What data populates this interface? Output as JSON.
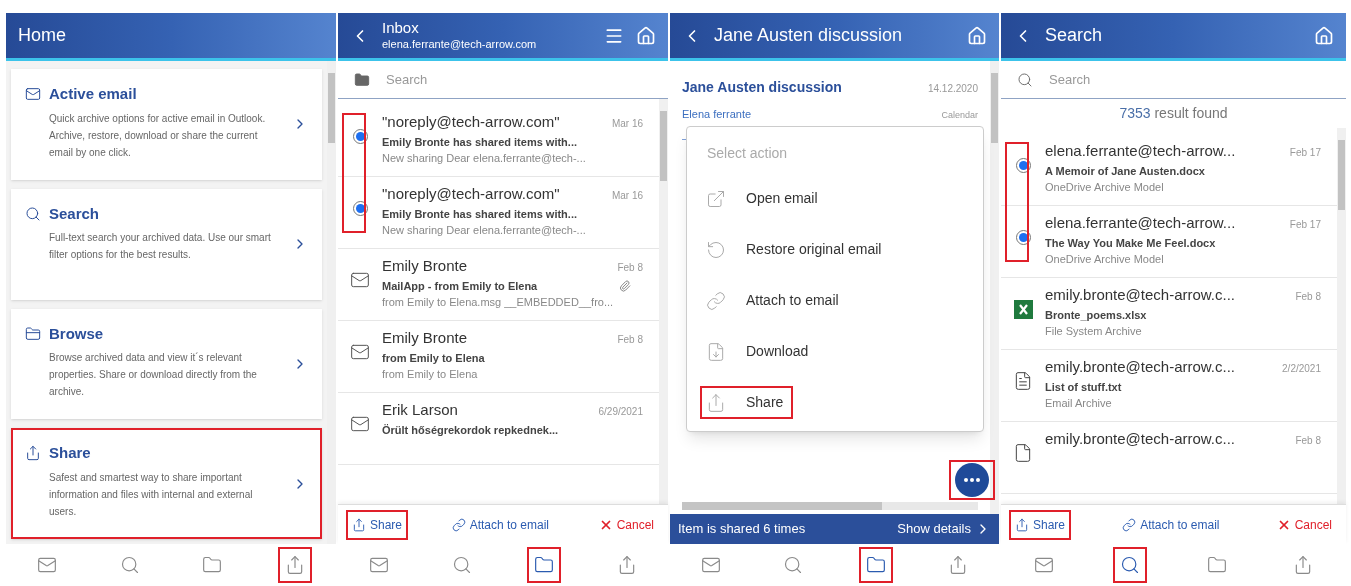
{
  "panels": [
    {
      "kind": "home",
      "header": {
        "title": "Home",
        "back": false,
        "menu": false,
        "home": false
      },
      "cards": [
        {
          "kind": "mail",
          "title": "Active email",
          "description": "Quick archive options for active email in Outlook. Archive, restore, download or share the current email by one click.",
          "highlighted": false
        },
        {
          "kind": "search",
          "title": "Search",
          "description": "Full-text search your archived data. Use our smart filter options for the best results.",
          "highlighted": false
        },
        {
          "kind": "browse",
          "title": "Browse",
          "description": "Browse archived data and view it´s relevant properties. Share or download directly from the archive.",
          "highlighted": false
        },
        {
          "kind": "share",
          "title": "Share",
          "description": "Safest and smartest way to share important information and files with internal and external users.",
          "highlighted": true
        }
      ],
      "nav": [
        {
          "kind": "mail",
          "selected": false,
          "highlighted": false
        },
        {
          "kind": "search",
          "selected": false,
          "highlighted": false
        },
        {
          "kind": "browse",
          "selected": false,
          "highlighted": false
        },
        {
          "kind": "share",
          "selected": false,
          "highlighted": true
        }
      ]
    },
    {
      "kind": "list",
      "header": {
        "title": "Inbox",
        "subtitle": "elena.ferrante@tech-arrow.com",
        "back": true,
        "menu": true,
        "home": true
      },
      "search": {
        "placeholder": "Search",
        "kind": "folder"
      },
      "selection_highlighted": true,
      "items": [
        {
          "selected": true,
          "title": "\"noreply@tech-arrow.com\"",
          "subject": "Emily Bronte has shared items with...",
          "preview": "New sharing Dear elena.ferrante@tech-...",
          "date": "Mar 16",
          "attachment": false
        },
        {
          "selected": true,
          "title": "\"noreply@tech-arrow.com\"",
          "subject": "Emily Bronte has shared items with...",
          "preview": "New sharing Dear elena.ferrante@tech-...",
          "date": "Mar 16",
          "attachment": false
        },
        {
          "selected": false,
          "kind": "email",
          "title": "Emily Bronte",
          "subject": "MailApp - from Emily to Elena",
          "preview": "from Emily to Elena.msg __EMBEDDED__fro...",
          "date": "Feb 8",
          "attachment": true
        },
        {
          "selected": false,
          "kind": "email",
          "title": "Emily Bronte",
          "subject": "from Emily to Elena",
          "preview": "from Emily to Elena",
          "date": "Feb 8",
          "attachment": false
        },
        {
          "selected": false,
          "kind": "email",
          "title": "Erik Larson",
          "subject": "Örült hőségrekordok repkednek...",
          "date": "6/29/2021",
          "attachment": false
        }
      ],
      "actions": [
        {
          "kind": "share",
          "label": "Share",
          "highlighted": true
        },
        {
          "kind": "attach",
          "label": "Attach to email",
          "highlighted": false
        },
        {
          "kind": "cancel",
          "label": "Cancel",
          "highlighted": false
        }
      ],
      "nav": [
        {
          "kind": "mail",
          "selected": false,
          "highlighted": false
        },
        {
          "kind": "search",
          "selected": false,
          "highlighted": false
        },
        {
          "kind": "browse",
          "selected": true,
          "highlighted": true
        },
        {
          "kind": "share",
          "selected": false,
          "highlighted": false
        }
      ]
    },
    {
      "kind": "detail",
      "header": {
        "title": "Jane Austen discussion",
        "back": true,
        "menu": false,
        "home": true
      },
      "content": {
        "title": "Jane Austen discussion",
        "date": "14.12.2020",
        "from": "Elena ferrante",
        "category": "Calendar"
      },
      "menu": {
        "title": "Select action",
        "items": [
          {
            "kind": "open",
            "label": "Open email",
            "highlighted": false
          },
          {
            "kind": "restore",
            "label": "Restore original email",
            "highlighted": false
          },
          {
            "kind": "attach",
            "label": "Attach to email",
            "highlighted": false
          },
          {
            "kind": "download",
            "label": "Download",
            "highlighted": false
          },
          {
            "kind": "share",
            "label": "Share",
            "highlighted": true
          }
        ]
      },
      "fab": {
        "highlighted": true
      },
      "banner": {
        "text": "Item is shared 6 times",
        "link": "Show details"
      },
      "nav": [
        {
          "kind": "mail",
          "selected": false,
          "highlighted": false
        },
        {
          "kind": "search",
          "selected": false,
          "highlighted": false
        },
        {
          "kind": "browse",
          "selected": true,
          "highlighted": true
        },
        {
          "kind": "share",
          "selected": false,
          "highlighted": false
        }
      ]
    },
    {
      "kind": "list",
      "header": {
        "title": "Search",
        "back": true,
        "menu": false,
        "home": true
      },
      "search": {
        "placeholder": "Search",
        "kind": "search"
      },
      "result_count": "7353",
      "result_label": "result found",
      "selection_highlighted": true,
      "items": [
        {
          "selected": true,
          "title": "elena.ferrante@tech-arrow...",
          "subject": "A Memoir of Jane Austen.docx",
          "preview": "OneDrive Archive Model",
          "date": "Feb 17"
        },
        {
          "selected": true,
          "title": "elena.ferrante@tech-arrow...",
          "subject": "The Way You Make Me Feel.docx",
          "preview": "OneDrive Archive Model",
          "date": "Feb 17"
        },
        {
          "selected": false,
          "kind": "spreadsheet",
          "title": "emily.bronte@tech-arrow.c...",
          "subject": "Bronte_poems.xlsx",
          "preview": "File System Archive",
          "date": "Feb 8"
        },
        {
          "selected": false,
          "kind": "text",
          "title": "emily.bronte@tech-arrow.c...",
          "subject": "List of stuff.txt",
          "preview": "Email Archive",
          "date": "2/2/2021"
        },
        {
          "selected": false,
          "kind": "document",
          "title": "emily.bronte@tech-arrow.c...",
          "date": "Feb 8"
        }
      ],
      "actions": [
        {
          "kind": "share",
          "label": "Share",
          "highlighted": true
        },
        {
          "kind": "attach",
          "label": "Attach to email",
          "highlighted": false
        },
        {
          "kind": "cancel",
          "label": "Cancel",
          "highlighted": false
        }
      ],
      "nav": [
        {
          "kind": "mail",
          "selected": false,
          "highlighted": false
        },
        {
          "kind": "search",
          "selected": true,
          "highlighted": true
        },
        {
          "kind": "browse",
          "selected": false,
          "highlighted": false
        },
        {
          "kind": "share",
          "selected": false,
          "highlighted": false
        }
      ]
    }
  ]
}
